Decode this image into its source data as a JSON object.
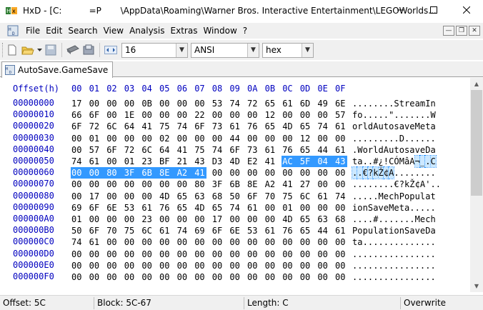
{
  "window": {
    "title": "HxD - [C:          =P       \\AppData\\Roaming\\Warner Bros. Interactive Entertainment\\LEGOWorlds...",
    "min_icon": "minimize-icon",
    "max_icon": "maximize-icon",
    "close_icon": "close-icon"
  },
  "menu": [
    "File",
    "Edit",
    "Search",
    "View",
    "Analysis",
    "Extras",
    "Window",
    "?"
  ],
  "toolbar": {
    "bytes_per_row": "16",
    "charset": "ANSI",
    "offset_base": "hex"
  },
  "tab": {
    "label": "AutoSave.GameSave"
  },
  "header": {
    "offset_label": "Offset(h)",
    "columns": [
      "00",
      "01",
      "02",
      "03",
      "04",
      "05",
      "06",
      "07",
      "08",
      "09",
      "0A",
      "0B",
      "0C",
      "0D",
      "0E",
      "0F"
    ]
  },
  "rows": [
    {
      "offset": "00000000",
      "bytes": [
        "17",
        "00",
        "00",
        "00",
        "0B",
        "00",
        "00",
        "00",
        "53",
        "74",
        "72",
        "65",
        "61",
        "6D",
        "49",
        "6E"
      ],
      "ascii": "........StreamIn"
    },
    {
      "offset": "00000010",
      "bytes": [
        "66",
        "6F",
        "00",
        "1E",
        "00",
        "00",
        "00",
        "22",
        "00",
        "00",
        "00",
        "12",
        "00",
        "00",
        "00",
        "57"
      ],
      "ascii": "fo.....\".......W"
    },
    {
      "offset": "00000020",
      "bytes": [
        "6F",
        "72",
        "6C",
        "64",
        "41",
        "75",
        "74",
        "6F",
        "73",
        "61",
        "76",
        "65",
        "4D",
        "65",
        "74",
        "61"
      ],
      "ascii": "orldAutosaveMeta"
    },
    {
      "offset": "00000030",
      "bytes": [
        "00",
        "01",
        "00",
        "00",
        "00",
        "02",
        "00",
        "00",
        "00",
        "44",
        "00",
        "00",
        "00",
        "12",
        "00",
        "00"
      ],
      "ascii": ".........D......"
    },
    {
      "offset": "00000040",
      "bytes": [
        "00",
        "57",
        "6F",
        "72",
        "6C",
        "64",
        "41",
        "75",
        "74",
        "6F",
        "73",
        "61",
        "76",
        "65",
        "44",
        "61"
      ],
      "ascii": ".WorldAutosaveDa"
    },
    {
      "offset": "00000050",
      "bytes": [
        "74",
        "61",
        "00",
        "01",
        "23",
        "BF",
        "21",
        "43",
        "D3",
        "4D",
        "E2",
        "41",
        "AC",
        "5F",
        "04",
        "43"
      ],
      "ascii": "ta..#¿!CÓMâA¬_.C"
    },
    {
      "offset": "00000060",
      "bytes": [
        "00",
        "00",
        "80",
        "3F",
        "6B",
        "8E",
        "A2",
        "41",
        "00",
        "00",
        "00",
        "00",
        "00",
        "00",
        "00",
        "00"
      ],
      "ascii": "..€?kŽ¢A........"
    },
    {
      "offset": "00000070",
      "bytes": [
        "00",
        "00",
        "00",
        "00",
        "00",
        "00",
        "00",
        "80",
        "3F",
        "6B",
        "8E",
        "A2",
        "41",
        "27",
        "00",
        "00"
      ],
      "ascii": "........€?kŽ¢A'.."
    },
    {
      "offset": "00000080",
      "bytes": [
        "00",
        "17",
        "00",
        "00",
        "00",
        "4D",
        "65",
        "63",
        "68",
        "50",
        "6F",
        "70",
        "75",
        "6C",
        "61",
        "74"
      ],
      "ascii": ".....MechPopulat"
    },
    {
      "offset": "00000090",
      "bytes": [
        "69",
        "6F",
        "6E",
        "53",
        "61",
        "76",
        "65",
        "4D",
        "65",
        "74",
        "61",
        "00",
        "01",
        "00",
        "00",
        "00"
      ],
      "ascii": "ionSaveMeta....."
    },
    {
      "offset": "000000A0",
      "bytes": [
        "01",
        "00",
        "00",
        "00",
        "23",
        "00",
        "00",
        "00",
        "17",
        "00",
        "00",
        "00",
        "4D",
        "65",
        "63",
        "68"
      ],
      "ascii": "....#.......Mech"
    },
    {
      "offset": "000000B0",
      "bytes": [
        "50",
        "6F",
        "70",
        "75",
        "6C",
        "61",
        "74",
        "69",
        "6F",
        "6E",
        "53",
        "61",
        "76",
        "65",
        "44",
        "61"
      ],
      "ascii": "PopulationSaveDa"
    },
    {
      "offset": "000000C0",
      "bytes": [
        "74",
        "61",
        "00",
        "00",
        "00",
        "00",
        "00",
        "00",
        "00",
        "00",
        "00",
        "00",
        "00",
        "00",
        "00",
        "00"
      ],
      "ascii": "ta.............."
    },
    {
      "offset": "000000D0",
      "bytes": [
        "00",
        "00",
        "00",
        "00",
        "00",
        "00",
        "00",
        "00",
        "00",
        "00",
        "00",
        "00",
        "00",
        "00",
        "00",
        "00"
      ],
      "ascii": "................"
    },
    {
      "offset": "000000E0",
      "bytes": [
        "00",
        "00",
        "00",
        "00",
        "00",
        "00",
        "00",
        "00",
        "00",
        "00",
        "00",
        "00",
        "00",
        "00",
        "00",
        "00"
      ],
      "ascii": "................"
    },
    {
      "offset": "000000F0",
      "bytes": [
        "00",
        "00",
        "00",
        "00",
        "00",
        "00",
        "00",
        "00",
        "00",
        "00",
        "00",
        "00",
        "00",
        "00",
        "00",
        "00"
      ],
      "ascii": "................"
    }
  ],
  "status": {
    "offset": "Offset: 5C",
    "block": "Block: 5C-67",
    "length": "Length: C",
    "mode": "Overwrite"
  },
  "colors": {
    "offset_blue": "#0000bf",
    "selection": "#3399ff",
    "ascii_selection": "#cce8ff"
  }
}
